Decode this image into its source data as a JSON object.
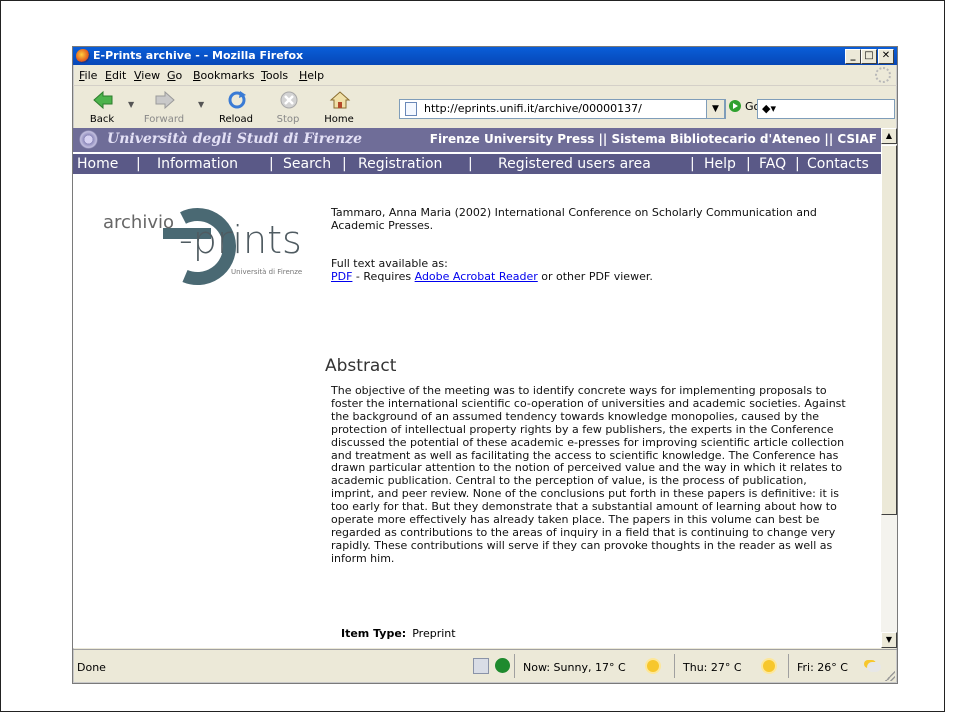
{
  "window": {
    "title": "E-Prints archive - - Mozilla Firefox"
  },
  "menubar": [
    "File",
    "Edit",
    "View",
    "Go",
    "Bookmarks",
    "Tools",
    "Help"
  ],
  "toolbar": {
    "back": "Back",
    "forward": "Forward",
    "reload": "Reload",
    "stop": "Stop",
    "home": "Home",
    "url": "http://eprints.unifi.it/archive/00000137/",
    "go": "Go"
  },
  "banner": {
    "university": "Università degli Studi di Firenze",
    "links": "Firenze University Press || Sistema Bibliotecario d'Ateneo || CSIAF"
  },
  "nav": {
    "home": "Home",
    "sep1": "|",
    "information": "Information",
    "sep2": "|",
    "search": "Search",
    "sep3": "|",
    "registration": "Registration",
    "sep4": "|",
    "registered": "Registered users area",
    "sep5": "|",
    "help": "Help",
    "sep6": "|",
    "faq": "FAQ",
    "sep7": "|",
    "contacts": "Contacts"
  },
  "logo": {
    "archivio": "archivio",
    "eprints": "-prints",
    "unifi": "Università di Firenze"
  },
  "record": {
    "citation": "Tammaro, Anna Maria (2002) International Conference on Scholarly Communication and Academic Presses.",
    "fulltext_label": "Full text available as:",
    "pdf_link": "PDF",
    "requires": " - Requires ",
    "acrobat_link": "Adobe Acrobat Reader",
    "viewer": " or other PDF viewer."
  },
  "abstract": {
    "heading": "Abstract",
    "text": "The objective of the meeting was to identify concrete ways for implementing proposals to foster the international scientific co-operation of universities and academic societies. Against the background of an assumed tendency towards knowledge monopolies, caused by the protection of intellectual property rights by a few publishers, the experts in the Conference discussed the potential of these academic e-presses for improving scientific article collection and treatment as well as facilitating the access to scientific knowledge. The Conference has drawn particular attention to the notion of perceived value and the way in which it relates to academic publication. Central to the perception of value, is the process of publication, imprint, and peer review. None of the conclusions put forth in these papers is definitive: it is too early for that. But they demonstrate that a substantial amount of learning about how to operate more effectively has already taken place. The papers in this volume can best be regarded as contributions to the areas of inquiry in a field that is continuing to change very rapidly. These contributions will serve if they can provoke thoughts in the reader as well as inform him."
  },
  "item_type": {
    "label": "Item Type:",
    "value": "Preprint"
  },
  "status": {
    "text": "Done",
    "weather_now": "Now: Sunny, 17° C",
    "weather_thu": "Thu: 27° C",
    "weather_fri": "Fri: 26° C"
  },
  "colors": {
    "banner": "#6f6d98",
    "nav": "#5a5987",
    "titlebar": "#0a5ed8",
    "link": "#0000ee"
  }
}
